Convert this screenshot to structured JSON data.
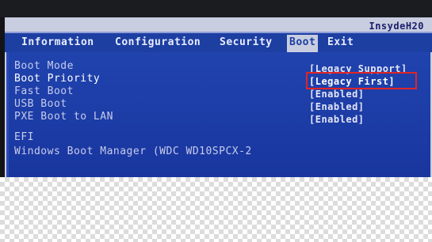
{
  "menubar": {
    "brand": "InsydeH20",
    "tabs": [
      {
        "label": "Information",
        "active": false
      },
      {
        "label": "Configuration",
        "active": false
      },
      {
        "label": "Security",
        "active": false
      },
      {
        "label": "Boot",
        "active": true
      },
      {
        "label": "Exit",
        "active": false
      }
    ]
  },
  "settings": [
    {
      "label": "Boot Mode",
      "value": "[Legacy Support]",
      "selected": false
    },
    {
      "label": "Boot Priority",
      "value": "[Legacy First]",
      "selected": true
    },
    {
      "label": "Fast Boot",
      "value": "[Enabled]",
      "selected": false
    },
    {
      "label": "USB Boot",
      "value": "[Enabled]",
      "selected": false
    },
    {
      "label": "PXE Boot to LAN",
      "value": "[Enabled]",
      "selected": false
    }
  ],
  "boot_list": {
    "header": "EFI",
    "items": [
      "Windows Boot Manager (WDC WD10SPCX-2"
    ]
  },
  "colors": {
    "menubar": "#1d3fa2",
    "content": "#1a37a0",
    "highlight": "#e02525",
    "screen_frame": "#c8cde0"
  }
}
